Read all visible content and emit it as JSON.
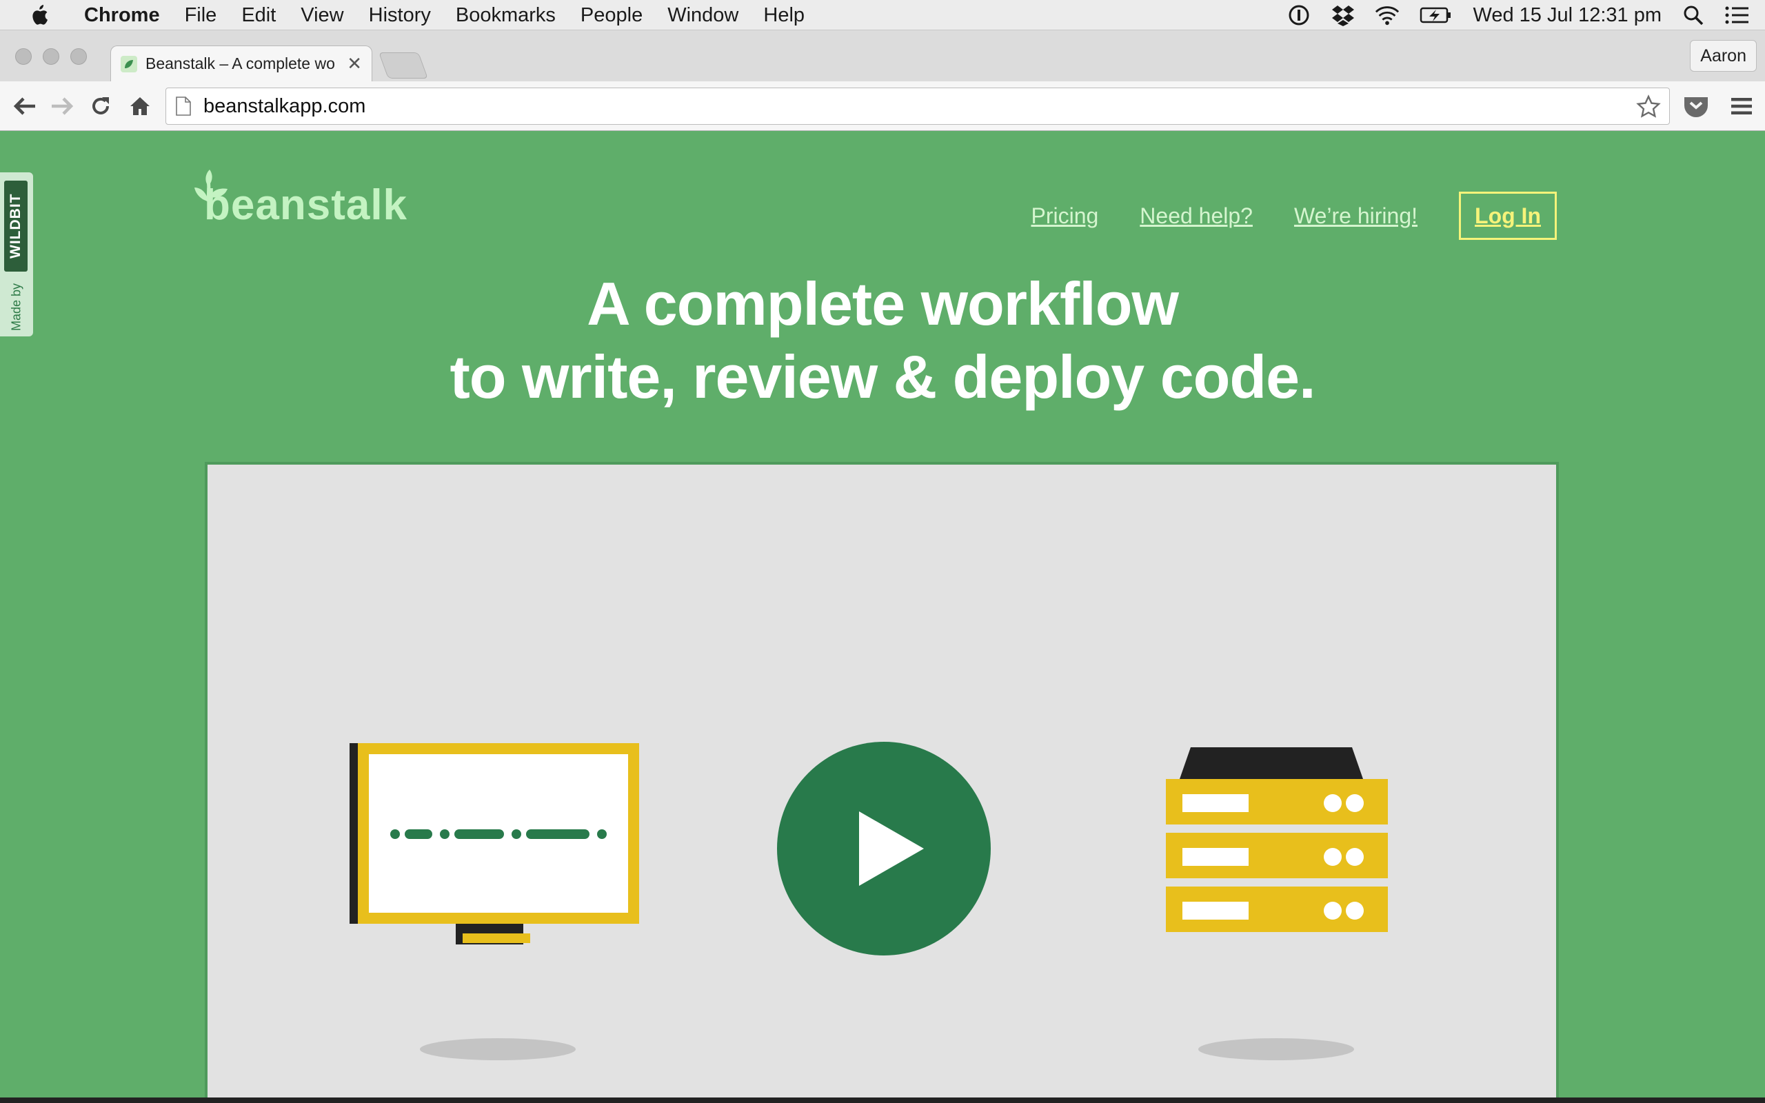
{
  "menubar": {
    "app_name": "Chrome",
    "items": [
      "File",
      "Edit",
      "View",
      "History",
      "Bookmarks",
      "People",
      "Window",
      "Help"
    ],
    "clock": "Wed 15 Jul  12:31 pm",
    "tray_icons": [
      "1password-icon",
      "dropbox-icon",
      "wifi-icon",
      "battery-icon",
      "spotlight-icon",
      "notification-center-icon"
    ]
  },
  "browser": {
    "tab_title": "Beanstalk – A complete wo",
    "profile_name": "Aaron",
    "url": "beanstalkapp.com"
  },
  "page": {
    "badge": {
      "made_by": "Made by",
      "brand": "WILDBIT"
    },
    "logo_text": "beanstalk",
    "nav": {
      "pricing": "Pricing",
      "help": "Need help?",
      "hiring": "We’re hiring!",
      "login": "Log In"
    },
    "headline_line1": "A complete workflow",
    "headline_line2": "to write, review & deploy code."
  },
  "colors": {
    "page_bg": "#5fae6a",
    "logo": "#c4f3c2",
    "login_accent": "#f6f37a",
    "play_button": "#287a4b",
    "illustration_yellow": "#e8bf1c"
  }
}
